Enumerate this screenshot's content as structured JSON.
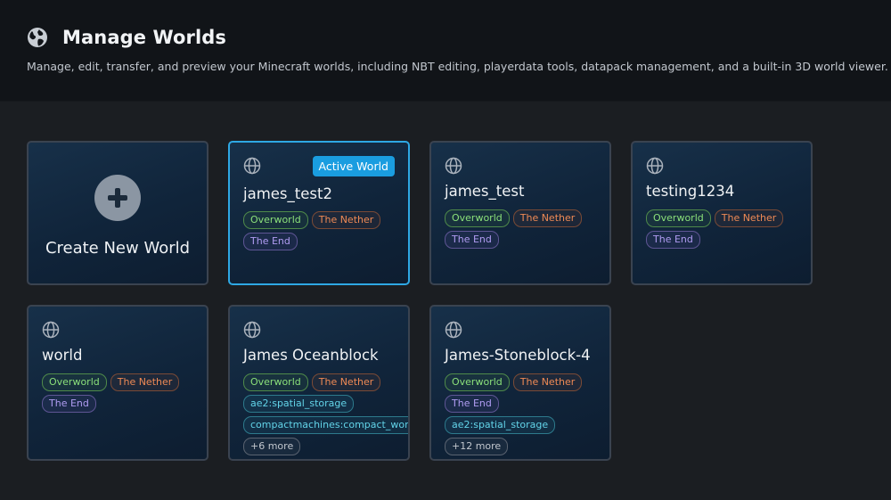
{
  "header": {
    "title": "Manage Worlds",
    "subtitle": "Manage, edit, transfer, and preview your Minecraft worlds, including NBT editing, playerdata tools, datapack management, and a built-in 3D world viewer."
  },
  "create": {
    "label": "Create New World"
  },
  "active_badge": "Active World",
  "colors": {
    "accent": "#1a9de0",
    "overworld": "#8be07a",
    "nether": "#ef8a55",
    "end": "#b09cf2",
    "mod": "#62d3e8"
  },
  "worlds": [
    {
      "name": "james_test2",
      "active": true,
      "dims": [
        "Overworld",
        "The Nether",
        "The End"
      ]
    },
    {
      "name": "james_test",
      "active": false,
      "dims": [
        "Overworld",
        "The Nether",
        "The End"
      ]
    },
    {
      "name": "testing1234",
      "active": false,
      "dims": [
        "Overworld",
        "The Nether",
        "The End"
      ]
    },
    {
      "name": "world",
      "active": false,
      "dims": [
        "Overworld",
        "The Nether",
        "The End"
      ]
    },
    {
      "name": "James Oceanblock",
      "active": false,
      "dims": [
        "Overworld",
        "The Nether",
        "ae2:spatial_storage",
        "compactmachines:compact_world"
      ],
      "more": "+6 more"
    },
    {
      "name": "James-Stoneblock-4",
      "active": false,
      "dims": [
        "Overworld",
        "The Nether",
        "The End",
        "ae2:spatial_storage"
      ],
      "more": "+12 more"
    }
  ]
}
